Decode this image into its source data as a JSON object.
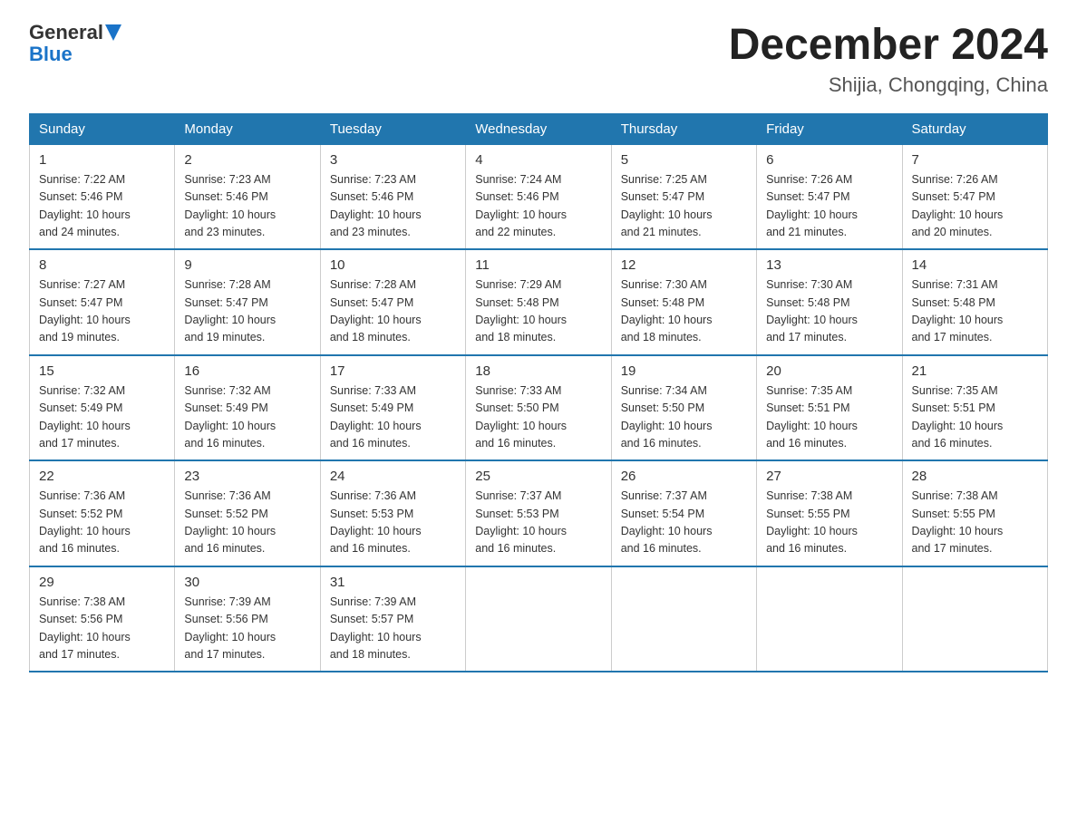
{
  "header": {
    "logo_line1": "General",
    "logo_line2": "Blue",
    "month_title": "December 2024",
    "location": "Shijia, Chongqing, China"
  },
  "days_of_week": [
    "Sunday",
    "Monday",
    "Tuesday",
    "Wednesday",
    "Thursday",
    "Friday",
    "Saturday"
  ],
  "weeks": [
    [
      {
        "day": "1",
        "sunrise": "7:22 AM",
        "sunset": "5:46 PM",
        "daylight": "10 hours and 24 minutes."
      },
      {
        "day": "2",
        "sunrise": "7:23 AM",
        "sunset": "5:46 PM",
        "daylight": "10 hours and 23 minutes."
      },
      {
        "day": "3",
        "sunrise": "7:23 AM",
        "sunset": "5:46 PM",
        "daylight": "10 hours and 23 minutes."
      },
      {
        "day": "4",
        "sunrise": "7:24 AM",
        "sunset": "5:46 PM",
        "daylight": "10 hours and 22 minutes."
      },
      {
        "day": "5",
        "sunrise": "7:25 AM",
        "sunset": "5:47 PM",
        "daylight": "10 hours and 21 minutes."
      },
      {
        "day": "6",
        "sunrise": "7:26 AM",
        "sunset": "5:47 PM",
        "daylight": "10 hours and 21 minutes."
      },
      {
        "day": "7",
        "sunrise": "7:26 AM",
        "sunset": "5:47 PM",
        "daylight": "10 hours and 20 minutes."
      }
    ],
    [
      {
        "day": "8",
        "sunrise": "7:27 AM",
        "sunset": "5:47 PM",
        "daylight": "10 hours and 19 minutes."
      },
      {
        "day": "9",
        "sunrise": "7:28 AM",
        "sunset": "5:47 PM",
        "daylight": "10 hours and 19 minutes."
      },
      {
        "day": "10",
        "sunrise": "7:28 AM",
        "sunset": "5:47 PM",
        "daylight": "10 hours and 18 minutes."
      },
      {
        "day": "11",
        "sunrise": "7:29 AM",
        "sunset": "5:48 PM",
        "daylight": "10 hours and 18 minutes."
      },
      {
        "day": "12",
        "sunrise": "7:30 AM",
        "sunset": "5:48 PM",
        "daylight": "10 hours and 18 minutes."
      },
      {
        "day": "13",
        "sunrise": "7:30 AM",
        "sunset": "5:48 PM",
        "daylight": "10 hours and 17 minutes."
      },
      {
        "day": "14",
        "sunrise": "7:31 AM",
        "sunset": "5:48 PM",
        "daylight": "10 hours and 17 minutes."
      }
    ],
    [
      {
        "day": "15",
        "sunrise": "7:32 AM",
        "sunset": "5:49 PM",
        "daylight": "10 hours and 17 minutes."
      },
      {
        "day": "16",
        "sunrise": "7:32 AM",
        "sunset": "5:49 PM",
        "daylight": "10 hours and 16 minutes."
      },
      {
        "day": "17",
        "sunrise": "7:33 AM",
        "sunset": "5:49 PM",
        "daylight": "10 hours and 16 minutes."
      },
      {
        "day": "18",
        "sunrise": "7:33 AM",
        "sunset": "5:50 PM",
        "daylight": "10 hours and 16 minutes."
      },
      {
        "day": "19",
        "sunrise": "7:34 AM",
        "sunset": "5:50 PM",
        "daylight": "10 hours and 16 minutes."
      },
      {
        "day": "20",
        "sunrise": "7:35 AM",
        "sunset": "5:51 PM",
        "daylight": "10 hours and 16 minutes."
      },
      {
        "day": "21",
        "sunrise": "7:35 AM",
        "sunset": "5:51 PM",
        "daylight": "10 hours and 16 minutes."
      }
    ],
    [
      {
        "day": "22",
        "sunrise": "7:36 AM",
        "sunset": "5:52 PM",
        "daylight": "10 hours and 16 minutes."
      },
      {
        "day": "23",
        "sunrise": "7:36 AM",
        "sunset": "5:52 PM",
        "daylight": "10 hours and 16 minutes."
      },
      {
        "day": "24",
        "sunrise": "7:36 AM",
        "sunset": "5:53 PM",
        "daylight": "10 hours and 16 minutes."
      },
      {
        "day": "25",
        "sunrise": "7:37 AM",
        "sunset": "5:53 PM",
        "daylight": "10 hours and 16 minutes."
      },
      {
        "day": "26",
        "sunrise": "7:37 AM",
        "sunset": "5:54 PM",
        "daylight": "10 hours and 16 minutes."
      },
      {
        "day": "27",
        "sunrise": "7:38 AM",
        "sunset": "5:55 PM",
        "daylight": "10 hours and 16 minutes."
      },
      {
        "day": "28",
        "sunrise": "7:38 AM",
        "sunset": "5:55 PM",
        "daylight": "10 hours and 17 minutes."
      }
    ],
    [
      {
        "day": "29",
        "sunrise": "7:38 AM",
        "sunset": "5:56 PM",
        "daylight": "10 hours and 17 minutes."
      },
      {
        "day": "30",
        "sunrise": "7:39 AM",
        "sunset": "5:56 PM",
        "daylight": "10 hours and 17 minutes."
      },
      {
        "day": "31",
        "sunrise": "7:39 AM",
        "sunset": "5:57 PM",
        "daylight": "10 hours and 18 minutes."
      },
      null,
      null,
      null,
      null
    ]
  ]
}
